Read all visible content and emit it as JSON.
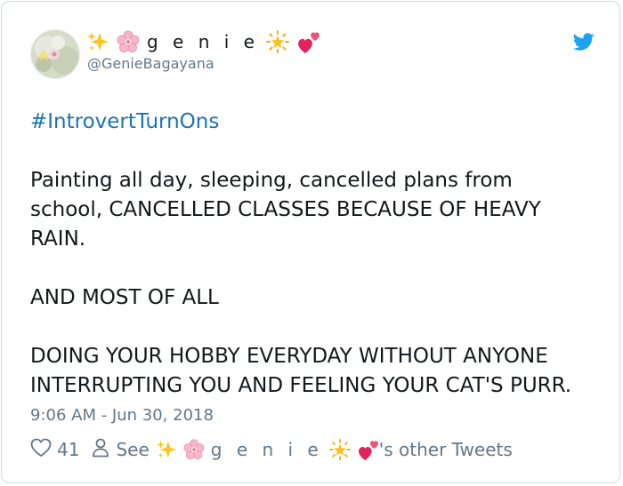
{
  "author": {
    "display_name": "g e n i e",
    "handle": "@GenieBagayana",
    "name_emojis_before": [
      "sparkles-icon",
      "cherry-blossom-icon"
    ],
    "name_emojis_after": [
      "glowing-star-icon",
      "two-hearts-icon"
    ]
  },
  "tweet": {
    "hashtag": "#IntrovertTurnOns",
    "paragraph_1": [
      "Painting all day, sleeping, cancelled plans from",
      "school, CANCELLED CLASSES BECAUSE OF HEAVY",
      "RAIN."
    ],
    "paragraph_2": [
      "AND MOST OF ALL"
    ],
    "paragraph_3": [
      "DOING YOUR HOBBY EVERYDAY WITHOUT ANYONE",
      "INTERRUPTING YOU AND FEELING YOUR CAT'S PURR."
    ],
    "timestamp": "9:06 AM - Jun 30, 2018"
  },
  "actions": {
    "like_count": "41",
    "see_prefix": "See",
    "see_name": "g e n i e",
    "see_suffix": "'s other Tweets"
  },
  "colors": {
    "link": "#1b74b5",
    "text": "#14171a",
    "muted": "#657786",
    "twitter_blue": "#1da1f2"
  },
  "icons": {
    "platform": "twitter-bird-icon",
    "like": "heart-outline-icon",
    "profile": "person-outline-icon"
  }
}
